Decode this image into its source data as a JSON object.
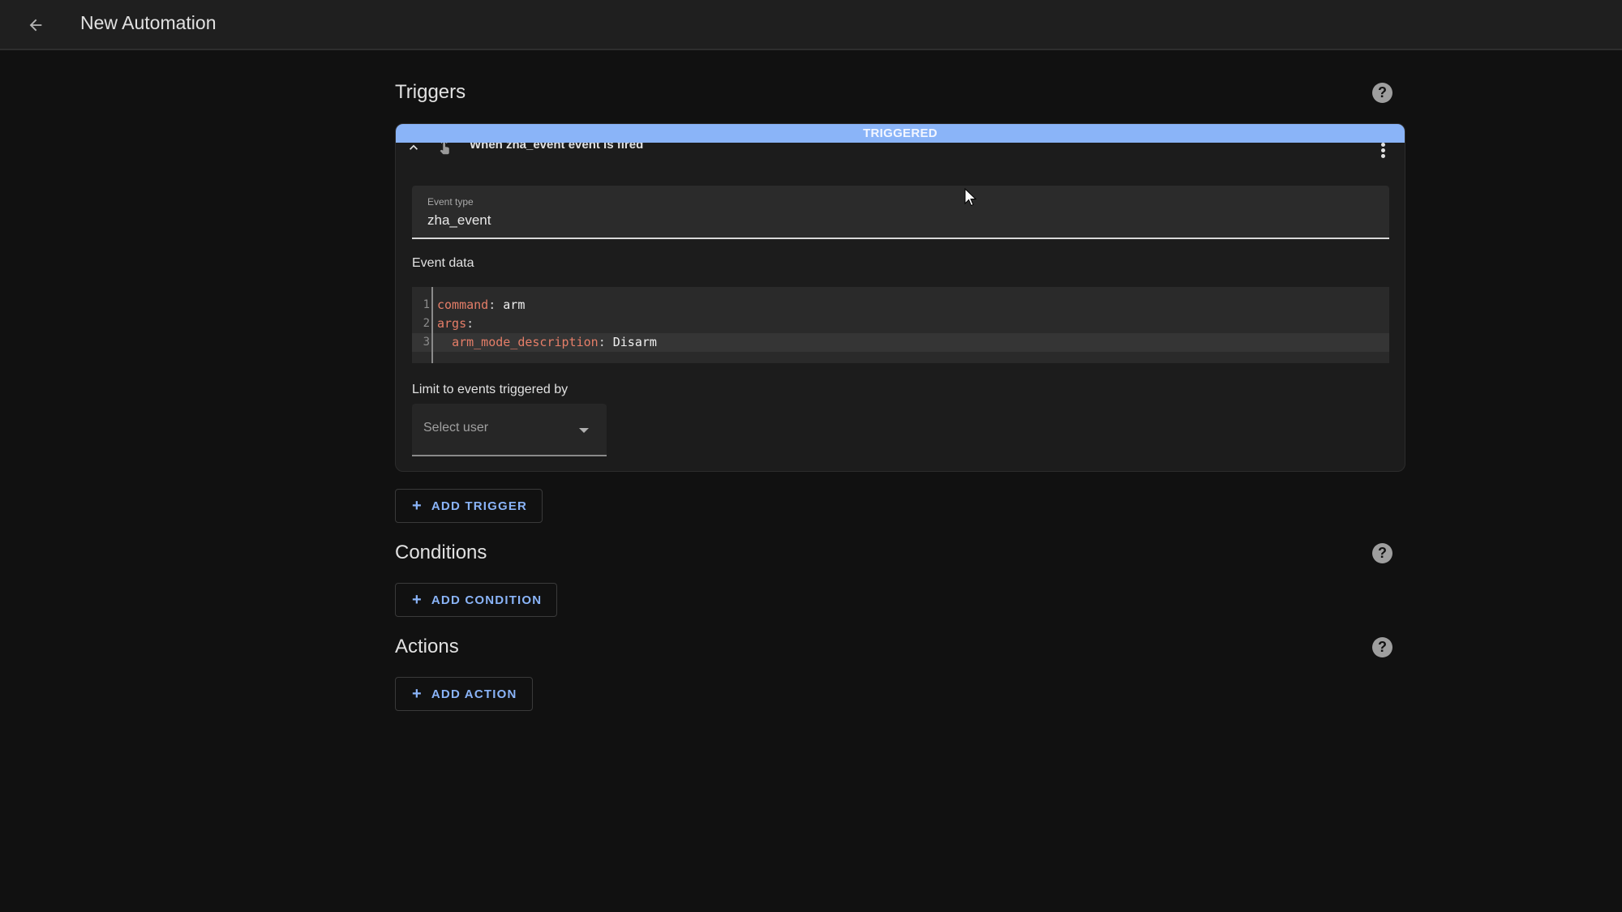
{
  "header": {
    "back_icon": "arrow-left-icon",
    "title": "New Automation"
  },
  "triggers": {
    "heading": "Triggers",
    "help_icon": "help-circle-icon",
    "help_glyph": "?",
    "items": [
      {
        "status_badge": "TRIGGERED",
        "status_color": "#8ab4f8",
        "collapse_icon": "chevron-up-icon",
        "type_icon": "gesture-tap-icon",
        "title": "When zha_event event is fired",
        "menu_icon": "dots-vertical-icon",
        "event_type": {
          "label": "Event type",
          "value": "zha_event"
        },
        "event_data": {
          "label": "Event data",
          "lines": [
            {
              "number": "1",
              "key": "command",
              "value": "arm",
              "indent": ""
            },
            {
              "number": "2",
              "key": "args",
              "value": "",
              "indent": ""
            },
            {
              "number": "3",
              "key": "arm_mode_description",
              "value": "Disarm",
              "indent": "  "
            }
          ]
        },
        "limit_by": {
          "label": "Limit to events triggered by",
          "placeholder": "Select user"
        }
      }
    ],
    "add_button": "ADD TRIGGER"
  },
  "conditions": {
    "heading": "Conditions",
    "help_glyph": "?",
    "add_button": "ADD CONDITION"
  },
  "actions": {
    "heading": "Actions",
    "help_glyph": "?",
    "add_button": "ADD ACTION"
  },
  "plus_glyph": "+",
  "colors": {
    "accent": "#8ab4f8",
    "yaml_key": "#e57e68",
    "background": "#111111",
    "topbar": "#1f1f1f"
  }
}
